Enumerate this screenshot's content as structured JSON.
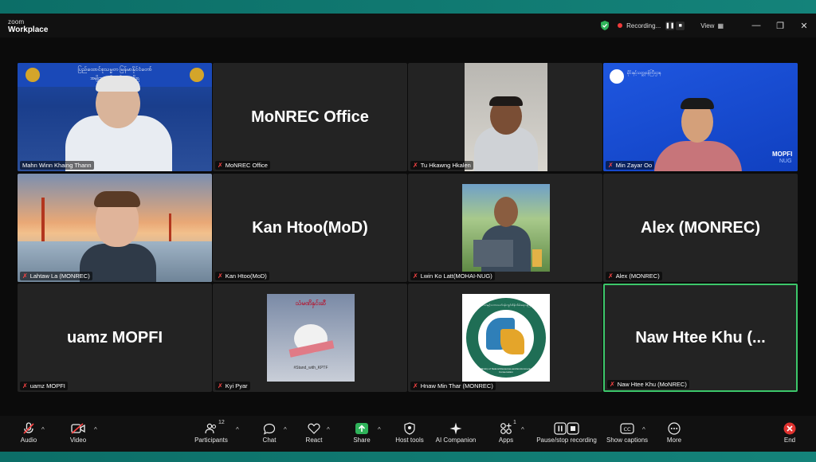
{
  "app": {
    "brand_small": "zoom",
    "brand_big": "Workplace"
  },
  "titlebar": {
    "recording": "Recording...",
    "view": "View",
    "pause_glyph": "❚❚",
    "stop_glyph": "■",
    "grid_glyph": "▦",
    "min_glyph": "—",
    "restore_glyph": "❐",
    "close_glyph": "✕"
  },
  "participants": [
    {
      "name": "Mahn Winn Khaing Thann",
      "muted": false,
      "kind": "video",
      "banner": "ပြည်ထောင်စုသမ္မတ မြန်မာနိုင်ငံတော်",
      "banner2": "အမျိုးသားညီညွတ်ရေးအစိုးရ"
    },
    {
      "name": "MoNREC Office",
      "muted": true,
      "kind": "name",
      "display": "MoNREC Office"
    },
    {
      "name": "Tu Hkawng Hkalen",
      "muted": true,
      "kind": "video"
    },
    {
      "name": "Min Zayar Oo",
      "muted": true,
      "kind": "video",
      "brand": "MOPFI",
      "brand_sub": "NUG",
      "header_text": "မိုင်းနှင့်သတ္တုဝန်ကြီးဌာန"
    },
    {
      "name": "Lahtaw La (MONREC)",
      "muted": true,
      "kind": "video"
    },
    {
      "name": "Kan Htoo(MoD)",
      "muted": true,
      "kind": "name",
      "display": "Kan Htoo(MoD)"
    },
    {
      "name": "Lwin Ko Latt(MOHAI-NUG)",
      "muted": true,
      "kind": "video"
    },
    {
      "name": "Alex (MONREC)",
      "muted": true,
      "kind": "name",
      "display": "Alex (MONREC)"
    },
    {
      "name": "uamz MOPFI",
      "muted": true,
      "kind": "name",
      "display": "uamz MOPFI"
    },
    {
      "name": "Kyi Pyar",
      "muted": true,
      "kind": "video",
      "poster_title": "သံမဏိနှင်းဆီ",
      "poster_caption": "#Stand_with_KPTF"
    },
    {
      "name": "Hnaw Min Thar (MONREC)",
      "muted": true,
      "kind": "video",
      "ring_top": "သယံဇာတနှင့်သဘာဝပတ်ဝန်းကျင်ထိန်းသိမ်းရေးဝန်ကြီးဌာန",
      "ring_bottom": "Ministry of Natural Resources and Environmental Conservation"
    },
    {
      "name": "Naw Htee Khu (MoNREC)",
      "muted": true,
      "kind": "name",
      "display": "Naw Htee Khu (...",
      "active_speaker": true
    }
  ],
  "toolbar": {
    "audio": "Audio",
    "video": "Video",
    "participants": "Participants",
    "participants_count": "12",
    "chat": "Chat",
    "react": "React",
    "share": "Share",
    "host_tools": "Host tools",
    "ai_companion": "AI Companion",
    "apps": "Apps",
    "apps_count": "1",
    "pause_stop": "Pause/stop recording",
    "captions": "Show captions",
    "more": "More",
    "end": "End",
    "caret": "^"
  },
  "colors": {
    "accent_green": "#3cc76a",
    "share_green": "#2fb35a",
    "mute_red": "#ff4545",
    "end_red": "#e0322f"
  }
}
